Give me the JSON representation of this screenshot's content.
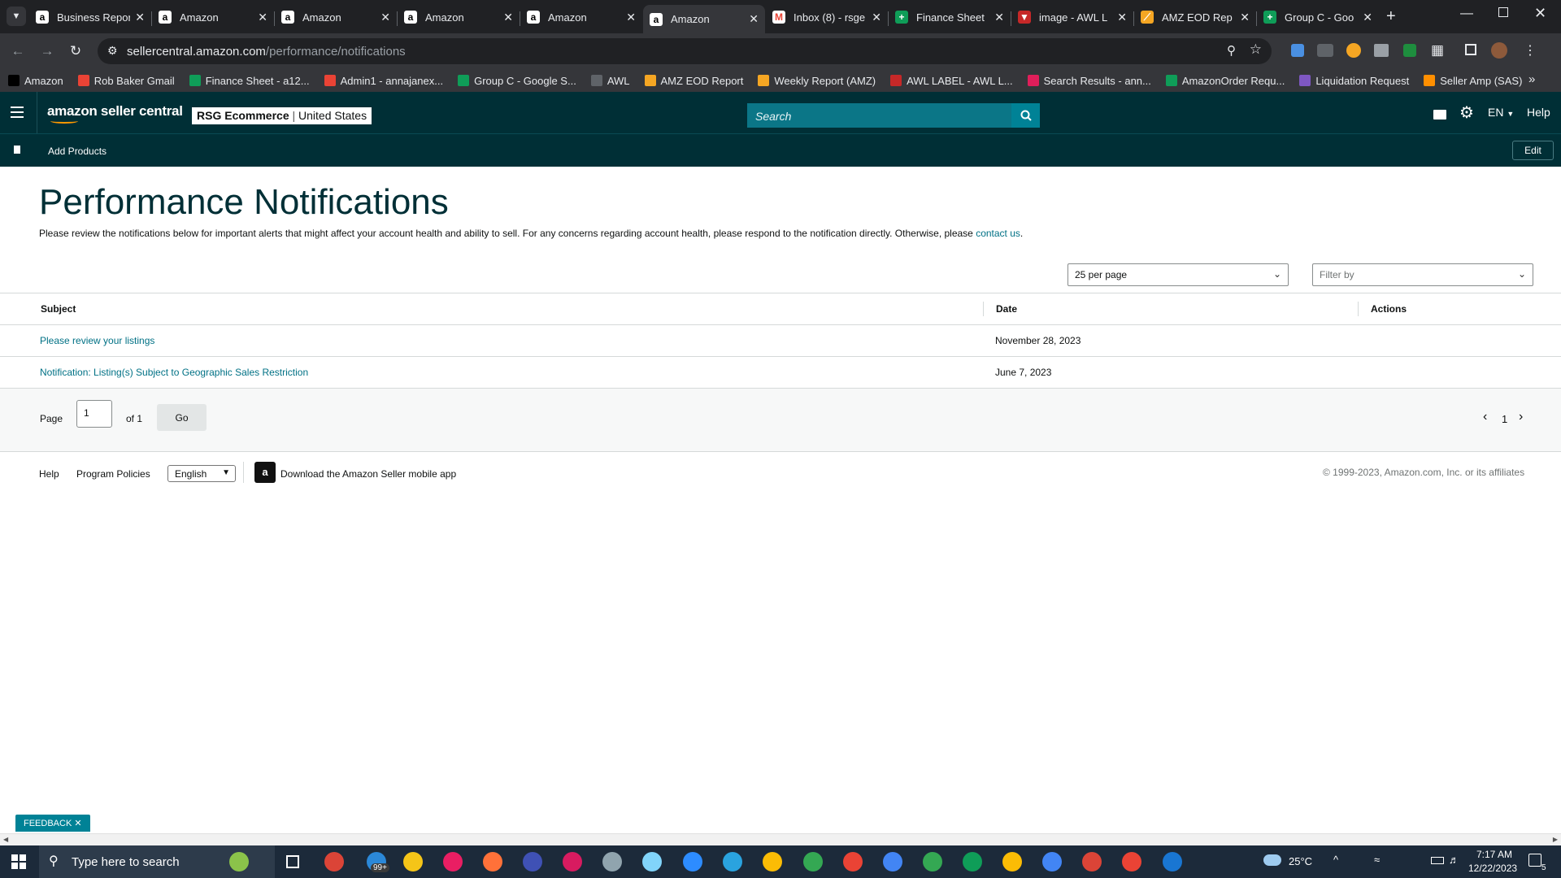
{
  "browser": {
    "tabs": [
      {
        "title": "Business Repor",
        "favicon": "amazon-icon",
        "active": false
      },
      {
        "title": "Amazon",
        "favicon": "amazon-icon",
        "active": false
      },
      {
        "title": "Amazon",
        "favicon": "amazon-icon",
        "active": false
      },
      {
        "title": "Amazon",
        "favicon": "amazon-icon",
        "active": false
      },
      {
        "title": "Amazon",
        "favicon": "amazon-icon",
        "active": false
      },
      {
        "title": "Amazon",
        "favicon": "amazon-icon",
        "active": true
      },
      {
        "title": "Inbox (8) - rsge",
        "favicon": "gmail-icon",
        "active": false
      },
      {
        "title": "Finance Sheet",
        "favicon": "sheets-icon",
        "active": false
      },
      {
        "title": "image - AWL L",
        "favicon": "awl-icon",
        "active": false
      },
      {
        "title": "AMZ EOD Rep",
        "favicon": "report-icon",
        "active": false
      },
      {
        "title": "Group C - Goo",
        "favicon": "sheets-icon",
        "active": false
      }
    ],
    "url_domain": "sellercentral.amazon.com",
    "url_path": "/performance/notifications",
    "bookmarks": [
      {
        "label": "Amazon",
        "icon": "amazon-icon"
      },
      {
        "label": "Rob Baker Gmail",
        "icon": "gmail-icon"
      },
      {
        "label": "Finance Sheet - a12...",
        "icon": "sheets-icon"
      },
      {
        "label": "Admin1 - annajanex...",
        "icon": "gmail-icon"
      },
      {
        "label": "Group C - Google S...",
        "icon": "sheets-icon"
      },
      {
        "label": "AWL",
        "icon": "globe-icon"
      },
      {
        "label": "AMZ EOD Report",
        "icon": "report-icon"
      },
      {
        "label": "Weekly Report (AMZ)",
        "icon": "report-icon"
      },
      {
        "label": "AWL LABEL - AWL L...",
        "icon": "awl-icon"
      },
      {
        "label": "Search Results - ann...",
        "icon": "slack-icon"
      },
      {
        "label": "AmazonOrder Requ...",
        "icon": "sheets-icon"
      },
      {
        "label": "Liquidation Request",
        "icon": "forms-icon"
      },
      {
        "label": "Seller Amp (SAS)",
        "icon": "selleramp-icon"
      }
    ]
  },
  "header": {
    "logo_text": "amazon seller central",
    "account_name": "RSG Ecommerce",
    "account_region": "United States",
    "search_placeholder": "Search",
    "language": "EN",
    "help": "Help"
  },
  "subnav": {
    "add_products": "Add Products",
    "edit": "Edit"
  },
  "page": {
    "title": "Performance Notifications",
    "intro": "Please review the notifications below for important alerts that might affect your account health and ability to sell. For any concerns regarding account health, please respond to the notification directly. Otherwise, please ",
    "contact_link": "contact us",
    "intro_end": ".",
    "per_page": "25 per page",
    "filter_placeholder": "Filter by"
  },
  "table": {
    "headers": {
      "subject": "Subject",
      "date": "Date",
      "actions": "Actions"
    },
    "rows": [
      {
        "subject": "Please review your listings",
        "date": "November 28, 2023"
      },
      {
        "subject": "Notification: Listing(s) Subject to Geographic Sales Restriction",
        "date": "June 7, 2023"
      }
    ]
  },
  "pagination": {
    "page_label": "Page",
    "page_value": "1",
    "of_label": "of 1",
    "go": "Go",
    "current": "1"
  },
  "footer": {
    "help": "Help",
    "policies": "Program Policies",
    "language": "English",
    "app_link": "Download the Amazon Seller mobile app",
    "copyright": "© 1999-2023, Amazon.com, Inc. or its affiliates"
  },
  "feedback": "FEEDBACK",
  "taskbar": {
    "search_placeholder": "Type here to search",
    "temperature": "25°C",
    "time": "7:17 AM",
    "date": "12/22/2023",
    "mail_badge": "99+",
    "notification_count": "5"
  },
  "colors": {
    "header_bg": "#002f36",
    "link": "#007185",
    "search_button": "#008296"
  }
}
